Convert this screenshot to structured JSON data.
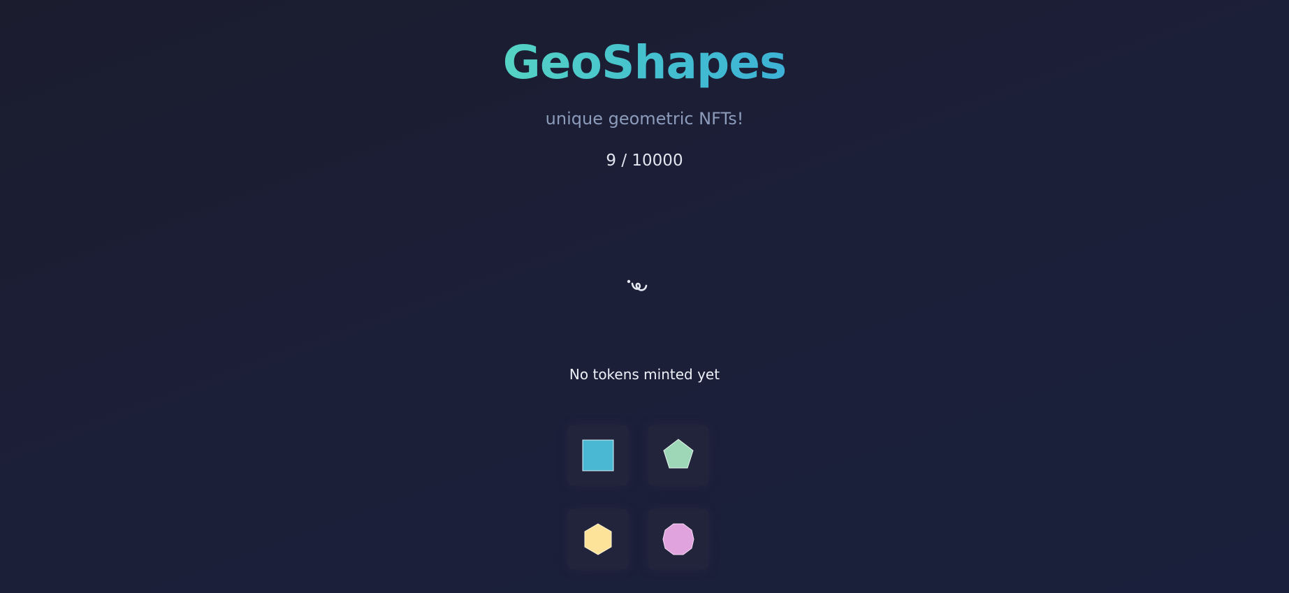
{
  "header": {
    "title": "GeoShapes",
    "subtitle": "unique geometric NFTs!",
    "minted_count": "9 / 10000"
  },
  "status": {
    "empty_message": "No tokens minted yet",
    "loading_icon": "spinner-icon"
  },
  "gallery": {
    "tiles": [
      {
        "shape": "square-icon",
        "color": "#4ab8d3"
      },
      {
        "shape": "pentagon-icon",
        "color": "#9dd7b8"
      },
      {
        "shape": "hexagon-icon",
        "color": "#fde39a"
      },
      {
        "shape": "octagon-icon",
        "color": "#e0a3de"
      }
    ]
  },
  "colors": {
    "background": "#1b1f38",
    "title_gradient_start": "#55d3c3",
    "title_gradient_end": "#3db2d6",
    "subtitle": "#8c9cba",
    "text": "#e3e6ef"
  }
}
